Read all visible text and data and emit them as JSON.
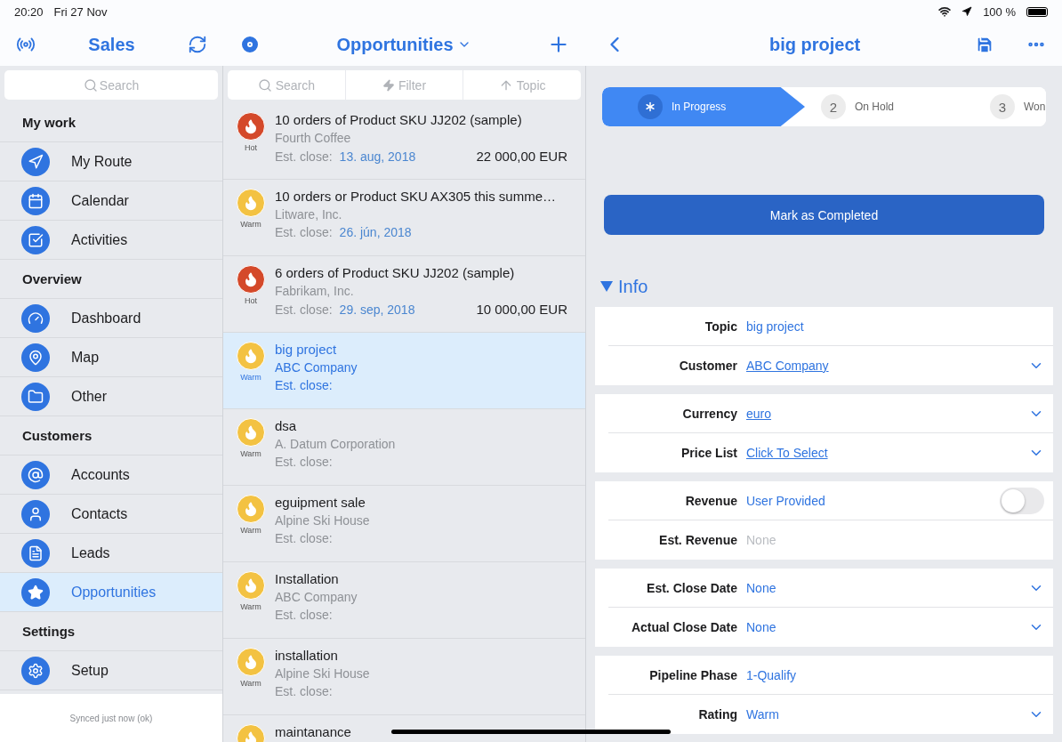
{
  "status_bar": {
    "time": "20:20",
    "date": "Fri 27 Nov",
    "battery": "100 %"
  },
  "sidebar": {
    "title": "Sales",
    "search_placeholder": "Search",
    "sections": [
      {
        "title": "My work",
        "items": [
          {
            "label": "My Route",
            "selected": false
          },
          {
            "label": "Calendar",
            "selected": false
          },
          {
            "label": "Activities",
            "selected": false
          }
        ]
      },
      {
        "title": "Overview",
        "items": [
          {
            "label": "Dashboard",
            "selected": false
          },
          {
            "label": "Map",
            "selected": false
          },
          {
            "label": "Other",
            "selected": false
          }
        ]
      },
      {
        "title": "Customers",
        "items": [
          {
            "label": "Accounts",
            "selected": false
          },
          {
            "label": "Contacts",
            "selected": false
          },
          {
            "label": "Leads",
            "selected": false
          },
          {
            "label": "Opportunities",
            "selected": true
          }
        ]
      },
      {
        "title": "Settings",
        "items": [
          {
            "label": "Setup",
            "selected": false
          }
        ]
      }
    ],
    "footer": "Synced just now (ok)"
  },
  "list": {
    "title": "Opportunities",
    "search_placeholder": "Search",
    "filter": "Filter",
    "sort": "Topic",
    "items": [
      {
        "title": "10 orders of Product SKU JJ202 (sample)",
        "rating": "Hot",
        "color": "#d4492a",
        "account": "Fourth Coffee",
        "close_label": "Est. close:",
        "close_date": "13. aug, 2018",
        "amount": "22 000,00 EUR",
        "selected": false
      },
      {
        "title": "10 orders or Product SKU AX305 this summe…",
        "rating": "Warm",
        "color": "#f3c242",
        "account": "Litware, Inc.",
        "close_label": "Est. close:",
        "close_date": "26. jún, 2018",
        "selected": false
      },
      {
        "title": "6 orders of Product SKU JJ202 (sample)",
        "rating": "Hot",
        "color": "#d4492a",
        "account": "Fabrikam, Inc.",
        "close_label": "Est. close:",
        "close_date": "29. sep, 2018",
        "amount": "10 000,00 EUR",
        "selected": false
      },
      {
        "title": "big project",
        "rating": "Warm",
        "color": "#f3c242",
        "account": "ABC Company",
        "close_label": "Est. close:",
        "selected": true
      },
      {
        "title": "dsa",
        "rating": "Warm",
        "color": "#f3c242",
        "account": "A. Datum Corporation",
        "close_label": "Est. close:",
        "selected": false
      },
      {
        "title": "eguipment sale",
        "rating": "Warm",
        "color": "#f3c242",
        "account": "Alpine Ski House",
        "close_label": "Est. close:",
        "selected": false
      },
      {
        "title": "Installation",
        "rating": "Warm",
        "color": "#f3c242",
        "account": "ABC Company",
        "close_label": "Est. close:",
        "selected": false
      },
      {
        "title": "installation",
        "rating": "Warm",
        "color": "#f3c242",
        "account": "Alpine Ski House",
        "close_label": "Est. close:",
        "selected": false
      },
      {
        "title": "maintanance",
        "color": "#f3c242",
        "selected": false
      }
    ]
  },
  "detail": {
    "title": "big project",
    "steps": [
      {
        "label": "In Progress",
        "selected": true
      },
      {
        "number": "2",
        "label": "On Hold",
        "selected": false
      },
      {
        "number": "3",
        "label": "Won",
        "selected": false
      }
    ],
    "action": "Mark as Completed",
    "section": "Info",
    "groups": [
      [
        {
          "label": "Topic",
          "value": "big project",
          "kind": "text"
        },
        {
          "label": "Customer",
          "value": "ABC Company",
          "kind": "lookup"
        }
      ],
      [
        {
          "label": "Currency",
          "value": "euro",
          "kind": "lookup"
        },
        {
          "label": "Price List",
          "value": "Click To Select",
          "kind": "lookup"
        }
      ],
      [
        {
          "label": "Revenue",
          "value": "User Provided",
          "kind": "toggle",
          "on": false
        },
        {
          "label": "Est. Revenue",
          "placeholder": "None",
          "kind": "placeholder"
        }
      ],
      [
        {
          "label": "Est. Close Date",
          "value": "None",
          "kind": "picker"
        },
        {
          "label": "Actual Close Date",
          "value": "None",
          "kind": "picker"
        }
      ],
      [
        {
          "label": "Pipeline Phase",
          "value": "1-Qualify",
          "kind": "text"
        },
        {
          "label": "Rating",
          "value": "Warm",
          "kind": "picker"
        }
      ]
    ]
  }
}
